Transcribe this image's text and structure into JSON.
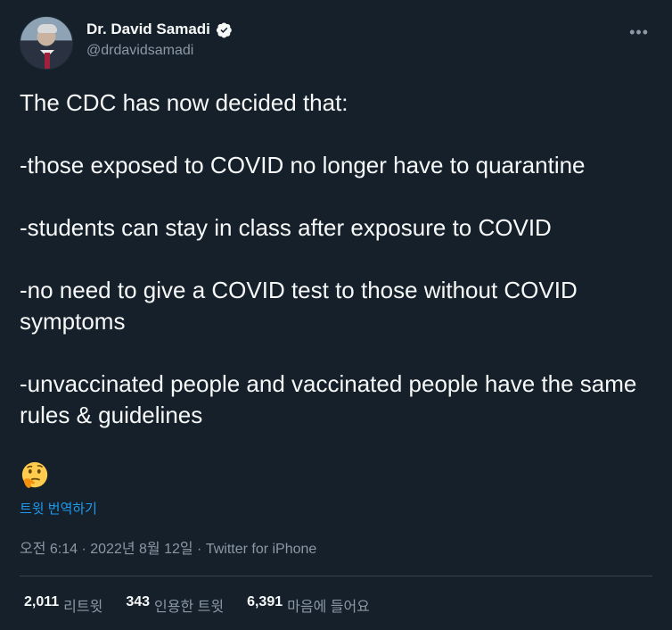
{
  "author": {
    "display_name": "Dr. David Samadi",
    "handle": "@drdavidsamadi",
    "verified": true
  },
  "tweet": {
    "lines": [
      "The CDC has now decided that:",
      "-those exposed to COVID no longer have to quarantine",
      "-students can stay in class after exposure to COVID",
      "-no need to give a COVID test to those without COVID symptoms",
      "-unvaccinated people and vaccinated people have the same rules & guidelines"
    ],
    "emoji": "thinking-face",
    "translate_label": "트윗 번역하기",
    "timestamp": "오전 6:14 · 2022년 8월 12일",
    "separator": " · ",
    "source": "Twitter for iPhone"
  },
  "stats": {
    "retweets_count": "2,011",
    "retweets_label": "리트윗",
    "quotes_count": "343",
    "quotes_label": "인용한 트윗",
    "likes_count": "6,391",
    "likes_label": "마음에 들어요"
  },
  "colors": {
    "background": "#15202b",
    "text": "#f7f9f9",
    "muted": "#8b98a5",
    "link": "#1d9bf0",
    "divider": "#38444d"
  }
}
